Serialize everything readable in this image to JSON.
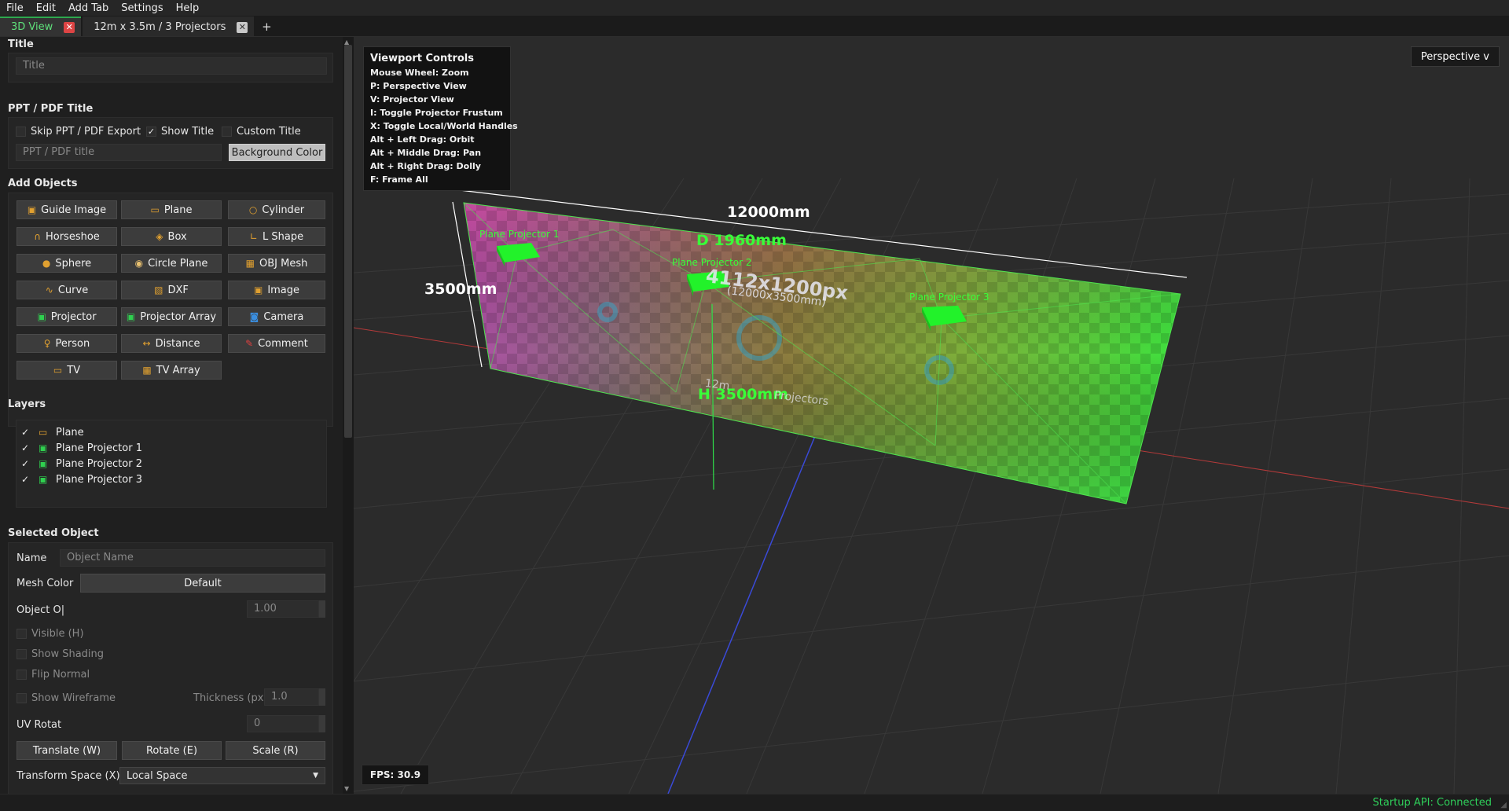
{
  "menu": [
    "File",
    "Edit",
    "Add Tab",
    "Settings",
    "Help"
  ],
  "tabs": [
    {
      "label": "3D View",
      "active": true
    },
    {
      "label": "12m x 3.5m / 3 Projectors",
      "active": false
    }
  ],
  "tab_add": "+",
  "title_section": {
    "heading": "Title",
    "placeholder": "Title"
  },
  "ppt_section": {
    "heading": "PPT / PDF Title",
    "skip_label": "Skip PPT / PDF Export",
    "show_title_label": "Show Title",
    "show_title_checked": true,
    "custom_title_label": "Custom Title",
    "placeholder": "PPT / PDF title",
    "bg_button": "Background Color"
  },
  "add_objects": {
    "heading": "Add Objects",
    "buttons": [
      {
        "label": "Guide Image",
        "icon": "image-icon",
        "glyph": "▣",
        "color": "#e0a030"
      },
      {
        "label": "Plane",
        "icon": "plane-icon",
        "glyph": "▭",
        "color": "#e0a030"
      },
      {
        "label": "Cylinder",
        "icon": "cylinder-icon",
        "glyph": "○",
        "color": "#e0a030"
      },
      {
        "label": "Horseshoe",
        "icon": "horseshoe-icon",
        "glyph": "∩",
        "color": "#e0a030"
      },
      {
        "label": "Box",
        "icon": "box-icon",
        "glyph": "◈",
        "color": "#e0a030"
      },
      {
        "label": "L Shape",
        "icon": "l-shape-icon",
        "glyph": "∟",
        "color": "#e0a030"
      },
      {
        "label": "Sphere",
        "icon": "sphere-icon",
        "glyph": "●",
        "color": "#e0a030"
      },
      {
        "label": "Circle Plane",
        "icon": "circle-plane-icon",
        "glyph": "◉",
        "color": "#e8c070"
      },
      {
        "label": "OBJ Mesh",
        "icon": "obj-mesh-icon",
        "glyph": "▦",
        "color": "#e0a030"
      },
      {
        "label": "Curve",
        "icon": "curve-icon",
        "glyph": "∿",
        "color": "#e0a030"
      },
      {
        "label": "DXF",
        "icon": "dxf-icon",
        "glyph": "▧",
        "color": "#e0a030"
      },
      {
        "label": "Image",
        "icon": "image-icon",
        "glyph": "▣",
        "color": "#e0a030"
      },
      {
        "label": "Projector",
        "icon": "projector-icon",
        "glyph": "▣",
        "color": "#2fd04f"
      },
      {
        "label": "Projector Array",
        "icon": "projector-array-icon",
        "glyph": "▣",
        "color": "#2fd04f"
      },
      {
        "label": "Camera",
        "icon": "camera-icon",
        "glyph": "◙",
        "color": "#3a8ee0"
      },
      {
        "label": "Person",
        "icon": "person-icon",
        "glyph": "♀",
        "color": "#e0a030"
      },
      {
        "label": "Distance",
        "icon": "distance-icon",
        "glyph": "↔",
        "color": "#e0a030"
      },
      {
        "label": "Comment",
        "icon": "comment-icon",
        "glyph": "✎",
        "color": "#e04040"
      },
      {
        "label": "TV",
        "icon": "tv-icon",
        "glyph": "▭",
        "color": "#e0a030"
      },
      {
        "label": "TV Array",
        "icon": "tv-array-icon",
        "glyph": "▦",
        "color": "#e0a030"
      }
    ]
  },
  "layers": {
    "heading": "Layers",
    "items": [
      {
        "label": "Plane",
        "checked": "✓",
        "icon": "plane-icon",
        "glyph": "▭",
        "color": "#e0a030"
      },
      {
        "label": "Plane Projector 1",
        "checked": "✓",
        "icon": "projector-icon",
        "glyph": "▣",
        "color": "#2fd04f"
      },
      {
        "label": "Plane Projector 2",
        "checked": "✓",
        "icon": "projector-icon",
        "glyph": "▣",
        "color": "#2fd04f"
      },
      {
        "label": "Plane Projector 3",
        "checked": "✓",
        "icon": "projector-icon",
        "glyph": "▣",
        "color": "#2fd04f"
      }
    ]
  },
  "selected": {
    "heading": "Selected Object",
    "name_label": "Name",
    "name_placeholder": "Object Name",
    "mesh_color_label": "Mesh Color",
    "mesh_color_value": "Default",
    "opacity_label": "Object O|",
    "opacity_value": "1.00",
    "visible_label": "Visible (H)",
    "shading_label": "Show Shading",
    "flip_label": "Flip Normal",
    "wire_label": "Show Wireframe",
    "thickness_label": "Thickness (px)",
    "thickness_value": "1.0",
    "uv_label": "UV Rotat",
    "uv_value": "0",
    "translate": "Translate (W)",
    "rotate": "Rotate (E)",
    "scale": "Scale (R)",
    "transform_label": "Transform Space (X)",
    "transform_value": "Local Space"
  },
  "viewport": {
    "controls_title": "Viewport Controls",
    "controls": [
      "Mouse Wheel: Zoom",
      "P: Perspective View",
      "V: Projector View",
      "I: Toggle Projector Frustum",
      "X: Toggle Local/World Handles",
      "Alt + Left Drag: Orbit",
      "Alt + Middle Drag: Pan",
      "Alt + Right Drag: Dolly",
      "F: Frame All"
    ],
    "view_mode": "Perspective v",
    "fps": "FPS: 30.9",
    "width_dim": "12000mm",
    "height_dim": "3500mm",
    "depth_label": "D 1960mm",
    "h_label": "H 3500mm",
    "resolution": "4112x1200px",
    "size_mm": "(12000x3500mm)",
    "screen_label_a": "12m",
    "screen_label_b": "Projectors",
    "projectors": [
      "Plane Projector 1",
      "Plane Projector 2",
      "Plane Projector 3"
    ]
  },
  "status": "Startup API: Connected",
  "colors": {
    "accent": "#2fd04f",
    "status": "#2fcf5a",
    "brand_orange": "#e0a030"
  }
}
